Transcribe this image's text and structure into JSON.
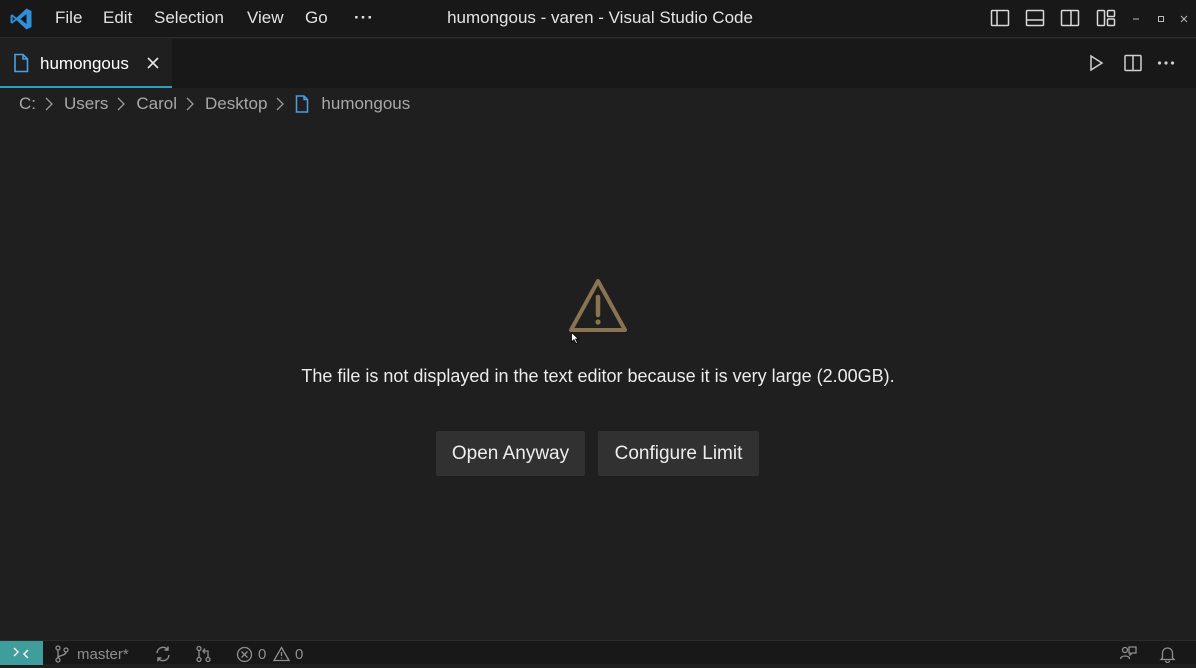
{
  "titlebar": {
    "app_icon": "vscode-logo-icon",
    "menu": {
      "file": "File",
      "edit": "Edit",
      "selection": "Selection",
      "view": "View",
      "go": "Go",
      "more": "···"
    },
    "window_title": "humongous - varen - Visual Studio Code",
    "layout_icons": [
      "toggle-primary-sidebar-icon",
      "toggle-panel-icon",
      "toggle-secondary-sidebar-icon",
      "customize-layout-icon"
    ],
    "window_controls": [
      "minimize-icon",
      "maximize-icon",
      "close-icon"
    ]
  },
  "tabs": [
    {
      "label": "humongous",
      "icon": "file-icon",
      "active": true,
      "close_icon": "close-icon"
    }
  ],
  "editor_actions": [
    "run-icon",
    "split-editor-icon",
    "more-actions-icon"
  ],
  "breadcrumb": {
    "items": [
      "C:",
      "Users",
      "Carol",
      "Desktop",
      "humongous"
    ],
    "separator_icon": "chevron-right-icon",
    "file_icon": "file-icon"
  },
  "editor": {
    "warning_icon": "warning-icon",
    "message": "The file is not displayed in the text editor because it is very large (2.00GB).",
    "buttons": {
      "open_anyway": "Open Anyway",
      "configure_limit": "Configure Limit"
    }
  },
  "statusbar": {
    "remote_icon": "remote-icon",
    "branch_icon": "source-control-icon",
    "branch": "master*",
    "sync_icon": "sync-icon",
    "pr_icon": "git-pull-request-icon",
    "errors": "0",
    "warnings": "0",
    "right_icons": [
      "feedback-icon",
      "bell-icon"
    ]
  },
  "colors": {
    "background": "#1f1f1f",
    "titlebar": "#181818",
    "tab_active_border": "#2aa3c0",
    "button_bg": "#313131",
    "warning_icon": "#8a7350",
    "remote_bg": "#3f9e9c",
    "file_icon": "#4a9fe0"
  }
}
